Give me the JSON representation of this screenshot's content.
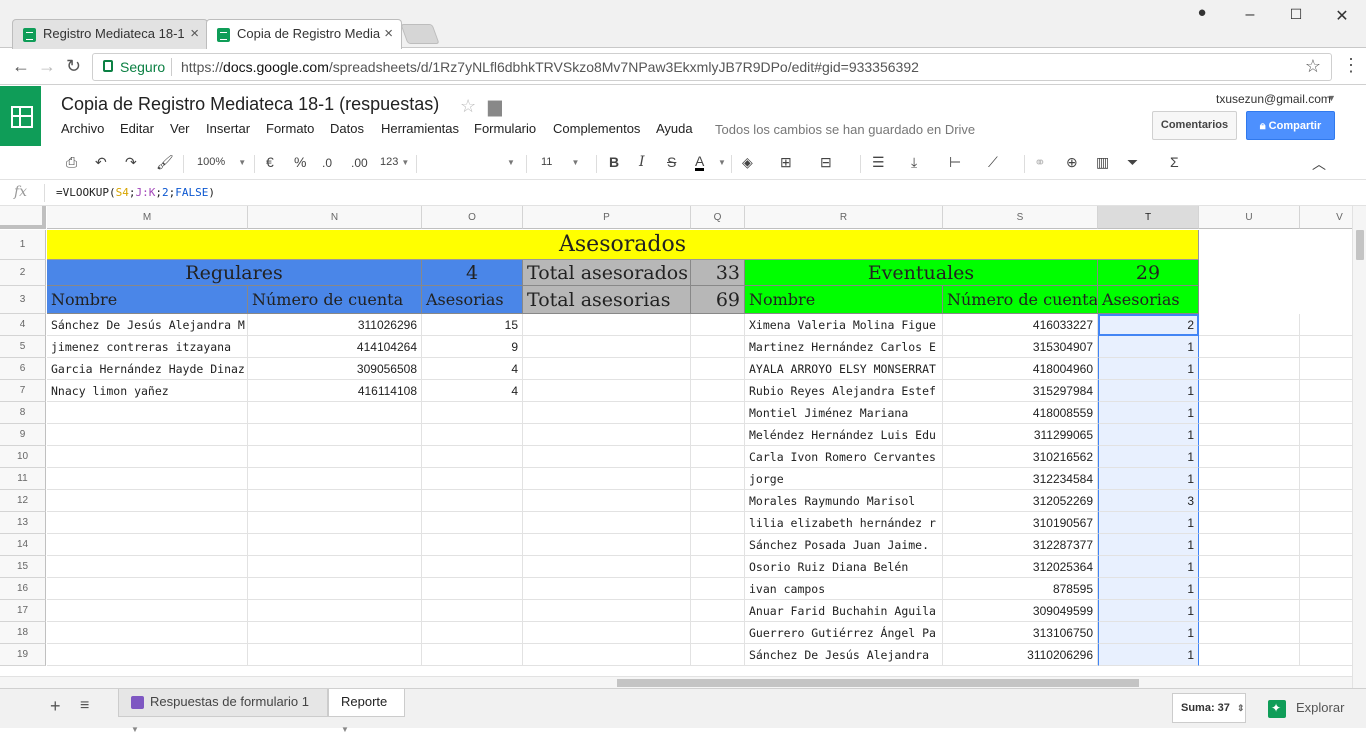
{
  "browser": {
    "tabs": [
      {
        "label": "Registro Mediateca 18-1",
        "active": false
      },
      {
        "label": "Copia de Registro Media",
        "active": true
      }
    ],
    "secure_label": "Seguro",
    "url_prefix": "https://",
    "url_host": "docs.google.com",
    "url_path": "/spreadsheets/d/1Rz7yNLfl6dbhkTRVSkzo8Mv7NPaw3EkxmlyJB7R9DPo/edit#gid=933356392"
  },
  "doc": {
    "title": "Copia de Registro Mediateca 18-1 (respuestas)",
    "account": "txusezun@gmail.com",
    "saved_status": "Todos los cambios se han guardado en Drive",
    "comments_label": "Comentarios",
    "share_label": "Compartir",
    "menu": [
      "Archivo",
      "Editar",
      "Ver",
      "Insertar",
      "Formato",
      "Datos",
      "Herramientas",
      "Formulario",
      "Complementos",
      "Ayuda"
    ]
  },
  "toolbar": {
    "zoom": "100%",
    "currency": "€",
    "percent": "%",
    "dec_less": ".0",
    "dec_more": ".00",
    "number_format": "123",
    "font_size": "11"
  },
  "formula": {
    "prefix": "=VLOOKUP(",
    "ref1": "S4",
    "sep1": ";",
    "ref2": "J:K",
    "sep2": ";",
    "num": "2",
    "sep3": ";",
    "bool": "FALSE",
    "suffix": ")"
  },
  "grid": {
    "columns": [
      "M",
      "N",
      "O",
      "P",
      "Q",
      "R",
      "S",
      "T",
      "U",
      "V"
    ],
    "selected_column": "T",
    "rows": [
      "1",
      "2",
      "3",
      "4",
      "5",
      "6",
      "7",
      "8",
      "9",
      "10",
      "11",
      "12",
      "13",
      "14",
      "15",
      "16",
      "17",
      "18",
      "19"
    ],
    "header": {
      "asesorados": "Asesorados",
      "regulares": "Regulares",
      "regulares_count": "4",
      "total_asesorados_label": "Total asesorados",
      "total_asesorados": "33",
      "eventuales": "Eventuales",
      "eventuales_count": "29",
      "nombre": "Nombre",
      "numero_cuenta": "Número de cuenta",
      "asesorias": "Asesorias",
      "total_asesorias_label": "Total asesorias",
      "total_asesorias": "69",
      "nombre2": "Nombre",
      "numero_cuenta2": "Número de cuenta",
      "asesorias2": "Asesorias"
    },
    "regulares": [
      {
        "nombre": "Sánchez De Jesús Alejandra M",
        "cuenta": "311026296",
        "asesorias": "15"
      },
      {
        "nombre": "jimenez contreras itzayana",
        "cuenta": "414104264",
        "asesorias": "9"
      },
      {
        "nombre": "Garcia Hernández Hayde Dinaz",
        "cuenta": "309056508",
        "asesorias": "4"
      },
      {
        "nombre": "Nnacy limon yañez",
        "cuenta": "416114108",
        "asesorias": "4"
      }
    ],
    "eventuales": [
      {
        "nombre": "Ximena Valeria Molina Figue",
        "cuenta": "416033227",
        "asesorias": "2"
      },
      {
        "nombre": "Martinez Hernández Carlos E",
        "cuenta": "315304907",
        "asesorias": "1"
      },
      {
        "nombre": "AYALA ARROYO ELSY MONSERRAT",
        "cuenta": "418004960",
        "asesorias": "1"
      },
      {
        "nombre": "Rubio Reyes Alejandra Estef",
        "cuenta": "315297984",
        "asesorias": "1"
      },
      {
        "nombre": "Montiel Jiménez Mariana",
        "cuenta": "418008559",
        "asesorias": "1"
      },
      {
        "nombre": "Meléndez Hernández Luis Edu",
        "cuenta": "311299065",
        "asesorias": "1"
      },
      {
        "nombre": "Carla Ivon Romero Cervantes",
        "cuenta": "310216562",
        "asesorias": "1"
      },
      {
        "nombre": "jorge",
        "cuenta": "312234584",
        "asesorias": "1"
      },
      {
        "nombre": "Morales Raymundo Marisol",
        "cuenta": "312052269",
        "asesorias": "3"
      },
      {
        "nombre": "lilia elizabeth hernández r",
        "cuenta": "310190567",
        "asesorias": "1"
      },
      {
        "nombre": "Sánchez Posada Juan Jaime.",
        "cuenta": "312287377",
        "asesorias": "1"
      },
      {
        "nombre": "Osorio Ruiz Diana Belén",
        "cuenta": "312025364",
        "asesorias": "1"
      },
      {
        "nombre": "ivan campos",
        "cuenta": "878595",
        "asesorias": "1"
      },
      {
        "nombre": "Anuar Farid Buchahin Aguila",
        "cuenta": "309049599",
        "asesorias": "1"
      },
      {
        "nombre": "Guerrero Gutiérrez Ángel Pa",
        "cuenta": "313106750",
        "asesorias": "1"
      },
      {
        "nombre": "Sánchez De Jesús Alejandra",
        "cuenta": "3110206296",
        "asesorias": "1"
      }
    ]
  },
  "sheets": {
    "tabs": [
      "Respuestas de formulario 1",
      "Reporte"
    ],
    "active": "Reporte",
    "suma": "Suma: 37",
    "explore": "Explorar"
  },
  "colors": {
    "yellow": "#ffff00",
    "blue": "#4a86e8",
    "gray": "#b7b7b7",
    "green": "#00ff00",
    "accent": "#4d90fe"
  }
}
